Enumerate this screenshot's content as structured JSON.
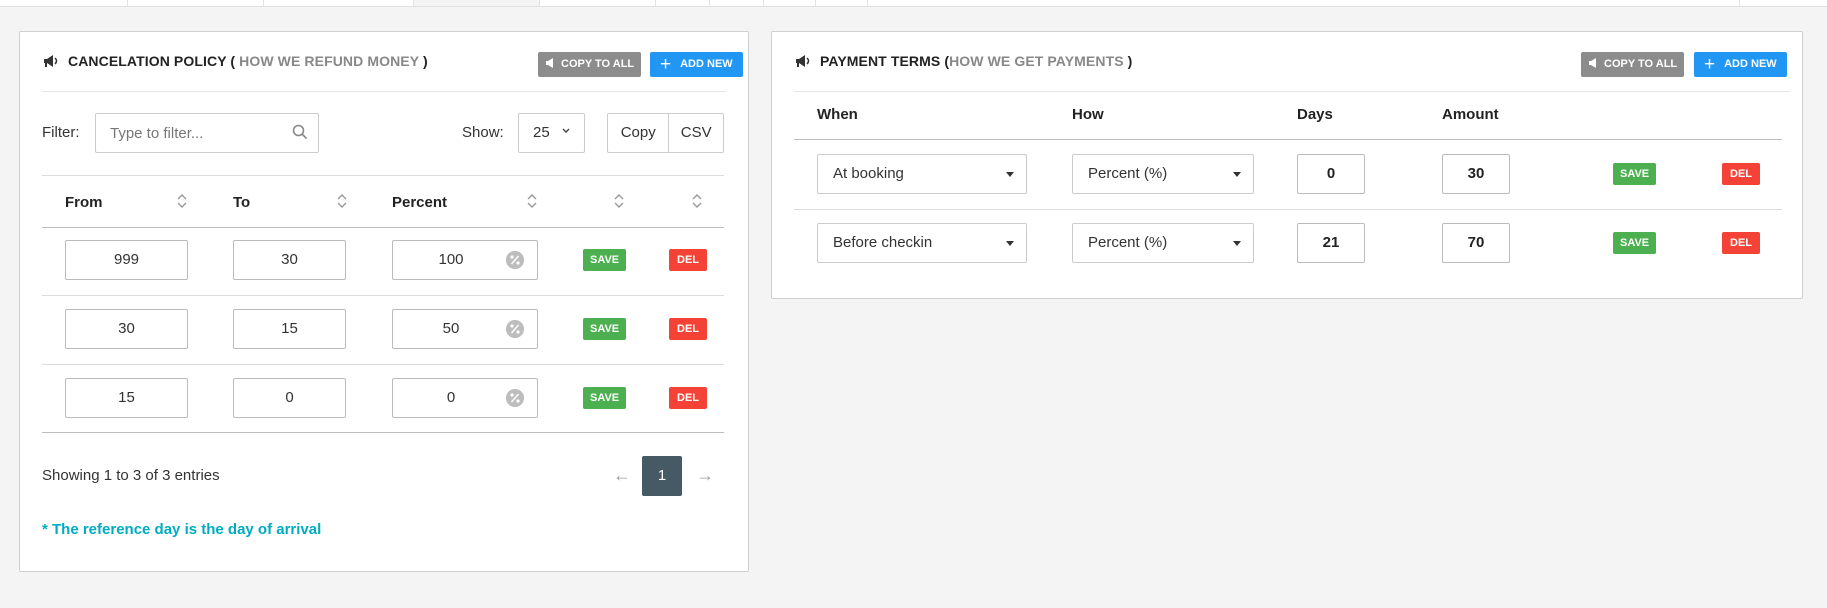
{
  "cancelation": {
    "title": "CANCELATION POLICY",
    "paren_open": "(",
    "subtitle": "HOW WE REFUND MONEY",
    "paren_close": ")",
    "copy_to_all": "COPY TO ALL",
    "add_new": "ADD NEW",
    "filter_label": "Filter:",
    "filter_placeholder": "Type to filter...",
    "show_label": "Show:",
    "show_value": "25",
    "copy_btn": "Copy",
    "csv_btn": "CSV",
    "columns": [
      "From",
      "To",
      "Percent"
    ],
    "rows": [
      {
        "from": "999",
        "to": "30",
        "percent": "100"
      },
      {
        "from": "30",
        "to": "15",
        "percent": "50"
      },
      {
        "from": "15",
        "to": "0",
        "percent": "0"
      }
    ],
    "save_label": "SAVE",
    "del_label": "DEL",
    "info": "Showing 1 to 3 of 3 entries",
    "pager_prev": "←",
    "pager_current": "1",
    "pager_next": "→",
    "note": "* The reference day is the day of arrival"
  },
  "payment": {
    "title": "PAYMENT TERMS",
    "paren_open": "(",
    "subtitle": "HOW WE GET PAYMENTS",
    "paren_close": ")",
    "copy_to_all": "COPY TO ALL",
    "add_new": "ADD NEW",
    "columns": [
      "When",
      "How",
      "Days",
      "Amount"
    ],
    "rows": [
      {
        "when": "At booking",
        "how": "Percent (%)",
        "days": "0",
        "amount": "30"
      },
      {
        "when": "Before checkin",
        "how": "Percent (%)",
        "days": "21",
        "amount": "70"
      }
    ],
    "save_label": "SAVE",
    "del_label": "DEL"
  },
  "colors": {
    "add_new": "#2196f3",
    "copy_to_all": "#8c8c8c",
    "save": "#4caf50",
    "del": "#f44336",
    "pager_active": "#455a64",
    "note": "#00acc1"
  },
  "icons": [
    "bullhorn-icon",
    "search-icon",
    "sort-icon",
    "percent-icon",
    "chevron-down-icon",
    "caret-down-icon",
    "plus-icon"
  ]
}
